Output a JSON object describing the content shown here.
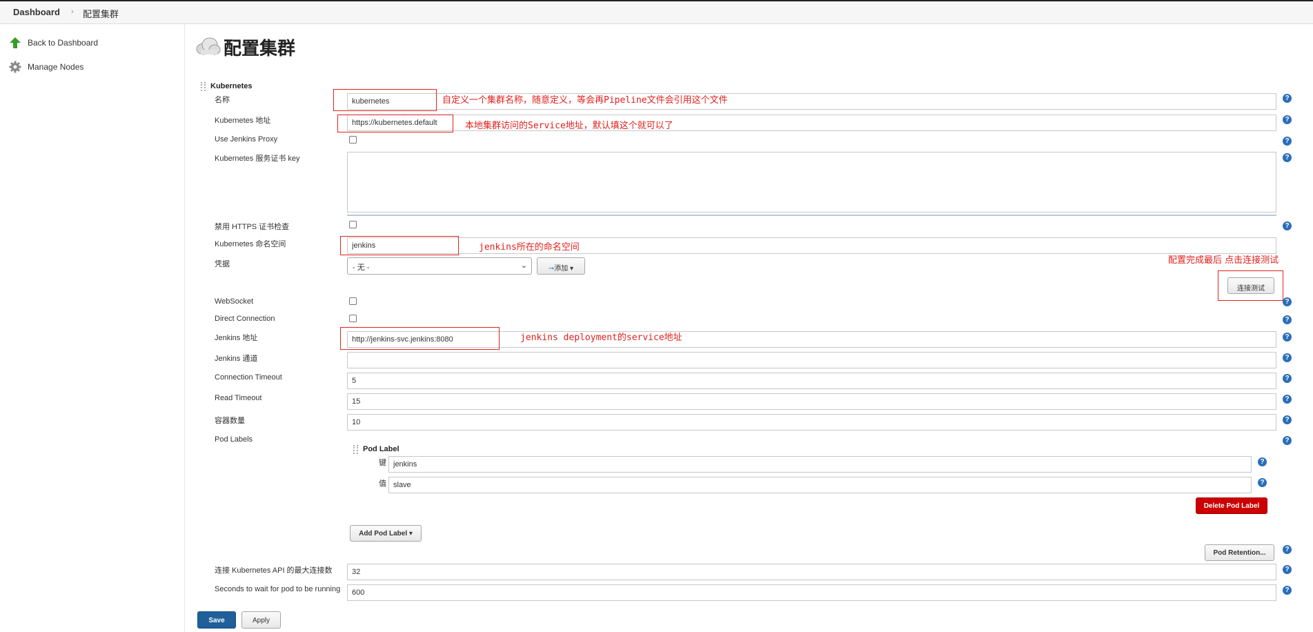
{
  "breadcrumb": {
    "dashboard": "Dashboard",
    "separator": "›",
    "current": "配置集群"
  },
  "sidebar": {
    "items": [
      {
        "label": "Back to Dashboard",
        "icon": "up-arrow-icon"
      },
      {
        "label": "Manage Nodes",
        "icon": "gear-icon"
      }
    ]
  },
  "page": {
    "title": "配置集群",
    "icon": "cloud-icon"
  },
  "section": {
    "title": "Kubernetes"
  },
  "fields": {
    "name": {
      "label": "名称",
      "value": "kubernetes"
    },
    "k8s_url": {
      "label": "Kubernetes 地址",
      "value": "https://kubernetes.default"
    },
    "use_proxy": {
      "label": "Use Jenkins Proxy"
    },
    "cert_key": {
      "label": "Kubernetes 服务证书 key"
    },
    "disable_https": {
      "label": "禁用 HTTPS 证书检查"
    },
    "namespace": {
      "label": "Kubernetes 命名空间",
      "value": "jenkins"
    },
    "credentials": {
      "label": "凭据",
      "selected": "- 无 -",
      "add_label": "添加"
    },
    "test_connection": {
      "label": "连接测试"
    },
    "websocket": {
      "label": "WebSocket"
    },
    "direct_connection": {
      "label": "Direct Connection"
    },
    "jenkins_url": {
      "label": "Jenkins 地址",
      "value": "http://jenkins-svc.jenkins:8080"
    },
    "jenkins_tunnel": {
      "label": "Jenkins 通道",
      "value": ""
    },
    "connection_timeout": {
      "label": "Connection Timeout",
      "value": "5"
    },
    "read_timeout": {
      "label": "Read Timeout",
      "value": "15"
    },
    "container_cap": {
      "label": "容器数量",
      "value": "10"
    },
    "pod_labels": {
      "label": "Pod Labels",
      "block_title": "Pod Label",
      "key_label": "键",
      "key_value": "jenkins",
      "value_label": "值",
      "value_value": "slave",
      "delete_label": "Delete Pod Label",
      "add_label": "Add Pod Label"
    },
    "pod_retention": {
      "label": "Pod Retention..."
    },
    "max_connections": {
      "label": "连接 Kubernetes API 的最大连接数",
      "value": "32"
    },
    "wait_seconds": {
      "label": "Seconds to wait for pod to be running",
      "value": "600"
    }
  },
  "buttons": {
    "save": "Save",
    "apply": "Apply"
  },
  "annotations": {
    "name_note": "自定义一个集群名称，随意定义，等会再Pipeline文件会引用这个文件",
    "url_note": "本地集群访问的Service地址，默认填这个就可以了",
    "namespace_note": "jenkins所在的命名空间",
    "test_note": "配置完成最后 点击连接测试",
    "jenkins_url_note": "jenkins deployment的service地址"
  },
  "colors": {
    "accent_blue": "#1f5f9a",
    "help_blue": "#2a6ebb",
    "danger_red": "#cc0000",
    "annotation_red": "#e0211d"
  }
}
